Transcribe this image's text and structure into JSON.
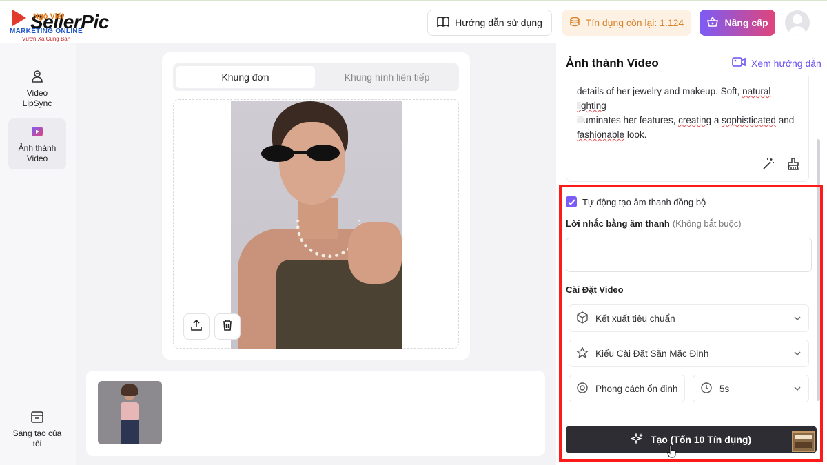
{
  "header": {
    "logo_text": "SellerPic",
    "logo_overlay": "Ngô Viết",
    "logo_sub1": "MARKETING ONLINE",
    "logo_sub2": "Vươn Xa Cùng Bạn",
    "guide_label": "Hướng dẫn sử dụng",
    "credit_label": "Tín dụng còn lại: 1.124",
    "upgrade_label": "Nâng cấp"
  },
  "sidebar": {
    "items": [
      {
        "label": "Video LipSync",
        "icon": "lipsync-icon"
      },
      {
        "label": "Ảnh thành Video",
        "icon": "image-to-video-icon"
      },
      {
        "label": "Sáng tạo của tôi",
        "icon": "creations-icon"
      }
    ]
  },
  "preview": {
    "tabs": [
      "Khung đơn",
      "Khung hình liên tiếp"
    ]
  },
  "panel": {
    "title": "Ảnh thành Video",
    "guide_label": "Xem hướng dẫn",
    "prompt_line1": "details of her jewelry and makeup. Soft, ",
    "prompt_line1_sq": "natural lighting",
    "prompt_line2a": "illuminates her features, ",
    "prompt_line2_sq": "creating",
    "prompt_line2b": " a ",
    "prompt_line2_sq2": "sophisticated",
    "prompt_line2c": " and",
    "prompt_line3_sq": "fashionable",
    "prompt_line3": " look.",
    "auto_audio_label": "Tự động tạo âm thanh đồng bộ",
    "audio_prompt_label": "Lời nhắc bằng âm thanh",
    "audio_prompt_optional": "(Không bắt buộc)",
    "video_settings_title": "Cài Đặt Video",
    "render_select": "Kết xuất tiêu chuẩn",
    "preset_select": "Kiểu Cài Đặt Sẵn Mặc Định",
    "style_select": "Phong cách ổn định",
    "duration_select": "5s",
    "generate_label": "Tạo (Tốn 10 Tín dụng)"
  },
  "colors": {
    "accent": "#7b5cf6",
    "highlight": "#ff1a1a",
    "credit_text": "#d9822b"
  }
}
